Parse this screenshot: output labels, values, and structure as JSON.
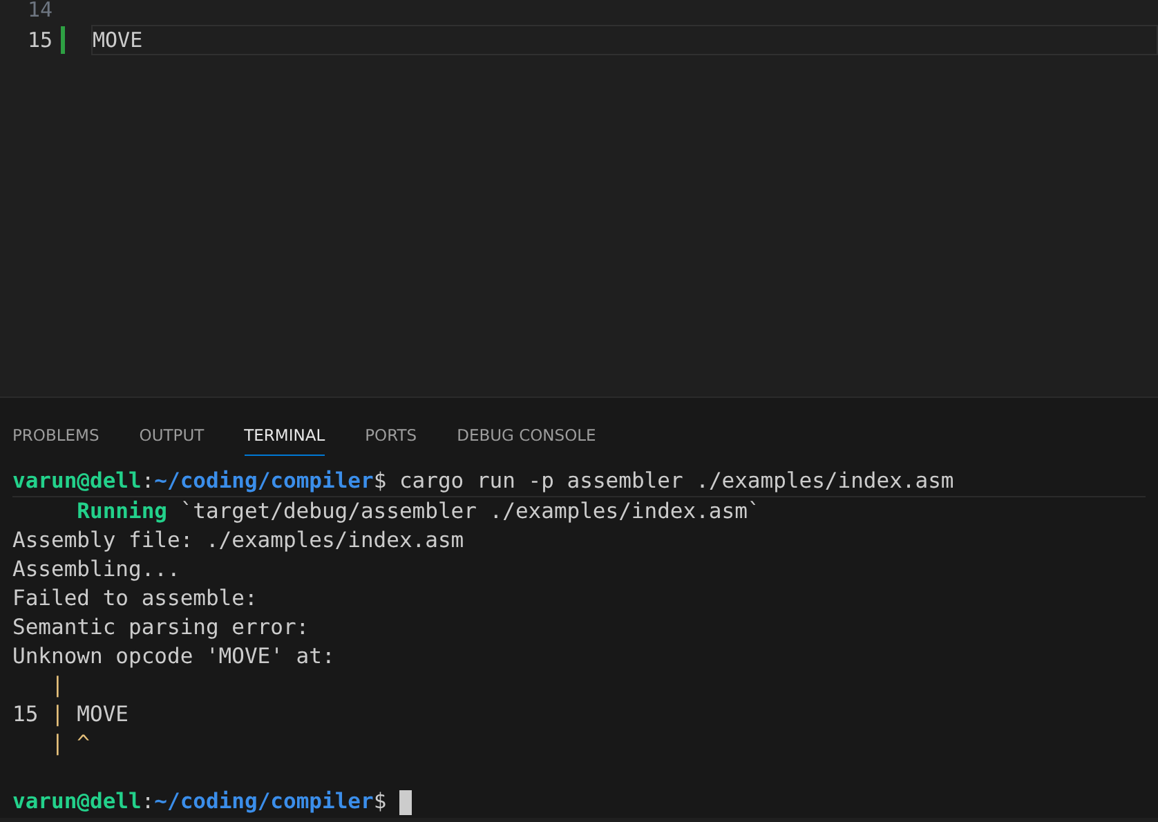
{
  "editor": {
    "lines": [
      {
        "number": "14",
        "modified": false,
        "current": false
      },
      {
        "number": "15",
        "text": "MOVE",
        "modified": true,
        "current": true
      }
    ]
  },
  "panel": {
    "tabs": [
      {
        "label": "PROBLEMS",
        "selected": false
      },
      {
        "label": "OUTPUT",
        "selected": false
      },
      {
        "label": "TERMINAL",
        "selected": true
      },
      {
        "label": "PORTS",
        "selected": false
      },
      {
        "label": "DEBUG CONSOLE",
        "selected": false
      }
    ]
  },
  "terminal": {
    "lines": [
      {
        "segments": [
          {
            "kind": "user",
            "text": "varun@dell"
          },
          {
            "kind": "plain",
            "text": ":"
          },
          {
            "kind": "path",
            "text": "~/coding/compiler"
          },
          {
            "kind": "plain",
            "text": "$ cargo run -p assembler ./examples/index.asm"
          }
        ]
      },
      {
        "segments": [
          {
            "kind": "running",
            "text": "     Running"
          },
          {
            "kind": "plain",
            "text": " `target/debug/assembler ./examples/index.asm`"
          }
        ]
      },
      {
        "segments": [
          {
            "kind": "plain",
            "text": "Assembly file: ./examples/index.asm"
          }
        ]
      },
      {
        "segments": [
          {
            "kind": "plain",
            "text": "Assembling..."
          }
        ]
      },
      {
        "segments": [
          {
            "kind": "plain",
            "text": "Failed to assemble:"
          }
        ]
      },
      {
        "segments": [
          {
            "kind": "plain",
            "text": "Semantic parsing error:"
          }
        ]
      },
      {
        "segments": [
          {
            "kind": "plain",
            "text": "Unknown opcode 'MOVE' at:"
          }
        ]
      },
      {
        "segments": [
          {
            "kind": "gutter",
            "text": "|"
          }
        ]
      },
      {
        "segments": [
          {
            "kind": "plain",
            "text": "15 "
          },
          {
            "kind": "gutter",
            "text": "|"
          },
          {
            "kind": "plain",
            "text": " MOVE"
          }
        ]
      },
      {
        "segments": [
          {
            "kind": "gutter",
            "text": "| ^"
          }
        ]
      },
      {
        "segments": [
          {
            "kind": "user",
            "text": "varun@dell"
          },
          {
            "kind": "plain",
            "text": ":"
          },
          {
            "kind": "path",
            "text": "~/coding/compiler"
          },
          {
            "kind": "plain",
            "text": "$ "
          }
        ],
        "cursor": true
      }
    ]
  }
}
